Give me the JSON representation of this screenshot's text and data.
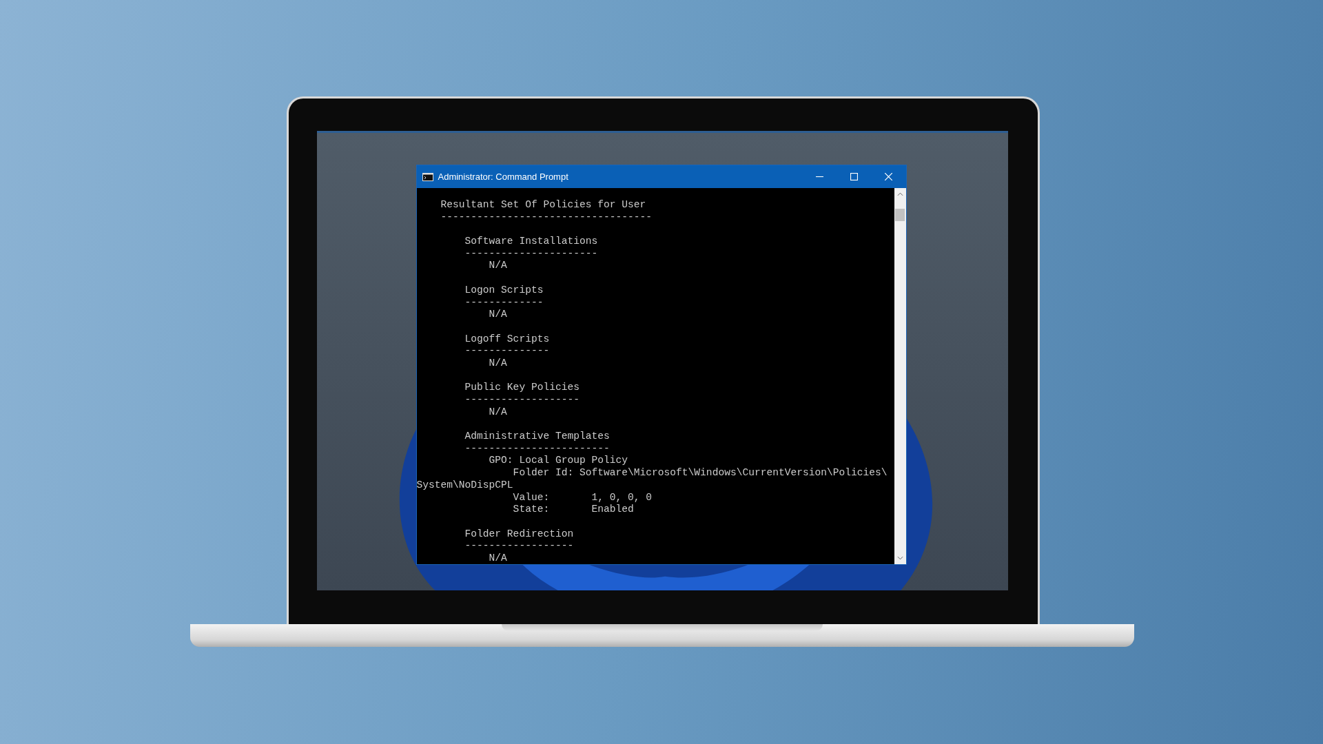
{
  "window": {
    "title": "Administrator: Command Prompt"
  },
  "console": {
    "heading": "    Resultant Set Of Policies for User",
    "heading_rule": "    -----------------------------------",
    "sections": [
      {
        "title": "        Software Installations",
        "rule": "        ----------------------",
        "lines": [
          "            N/A"
        ]
      },
      {
        "title": "        Logon Scripts",
        "rule": "        -------------",
        "lines": [
          "            N/A"
        ]
      },
      {
        "title": "        Logoff Scripts",
        "rule": "        --------------",
        "lines": [
          "            N/A"
        ]
      },
      {
        "title": "        Public Key Policies",
        "rule": "        -------------------",
        "lines": [
          "            N/A"
        ]
      },
      {
        "title": "        Administrative Templates",
        "rule": "        ------------------------",
        "lines": [
          "            GPO: Local Group Policy",
          "                Folder Id: Software\\Microsoft\\Windows\\CurrentVersion\\Policies\\",
          "System\\NoDispCPL",
          "                Value:       1, 0, 0, 0",
          "                State:       Enabled"
        ]
      },
      {
        "title": "        Folder Redirection",
        "rule": "        ------------------",
        "lines": [
          "            N/A"
        ]
      }
    ]
  }
}
